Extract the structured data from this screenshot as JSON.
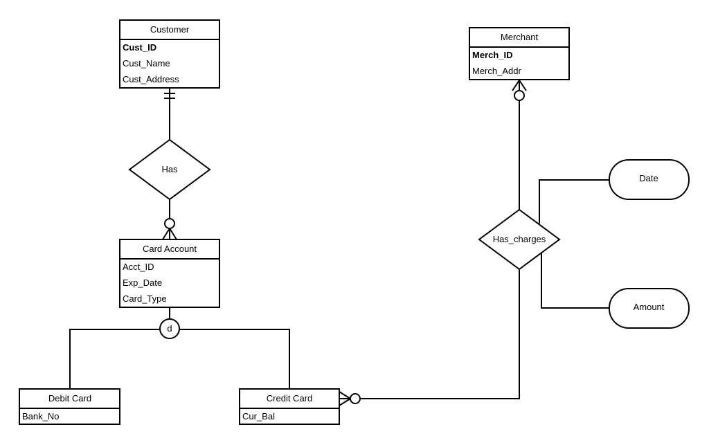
{
  "entities": [
    {
      "id": "customer",
      "title": "Customer",
      "attributes": [
        {
          "name": "Cust_ID",
          "key": true
        },
        {
          "name": "Cust_Name",
          "key": false
        },
        {
          "name": "Cust_Address",
          "key": false
        }
      ]
    },
    {
      "id": "merchant",
      "title": "Merchant",
      "attributes": [
        {
          "name": "Merch_ID",
          "key": true
        },
        {
          "name": "Merch_Addr",
          "key": false
        }
      ]
    },
    {
      "id": "card-account",
      "title": "Card Account",
      "attributes": [
        {
          "name": "Acct_ID",
          "key": false
        },
        {
          "name": "Exp_Date",
          "key": false
        },
        {
          "name": "Card_Type",
          "key": false
        }
      ]
    },
    {
      "id": "debit-card",
      "title": "Debit Card",
      "attributes": [
        {
          "name": "Bank_No",
          "key": false
        }
      ]
    },
    {
      "id": "credit-card",
      "title": "Credit Card",
      "attributes": [
        {
          "name": "Cur_Bal",
          "key": false
        }
      ]
    }
  ],
  "relationships": [
    {
      "id": "has",
      "label": "Has"
    },
    {
      "id": "has-charges",
      "label": "Has_charges"
    }
  ],
  "relationship_attributes": [
    {
      "id": "date",
      "label": "Date"
    },
    {
      "id": "amount",
      "label": "Amount"
    }
  ],
  "specialization": {
    "label": "d"
  }
}
